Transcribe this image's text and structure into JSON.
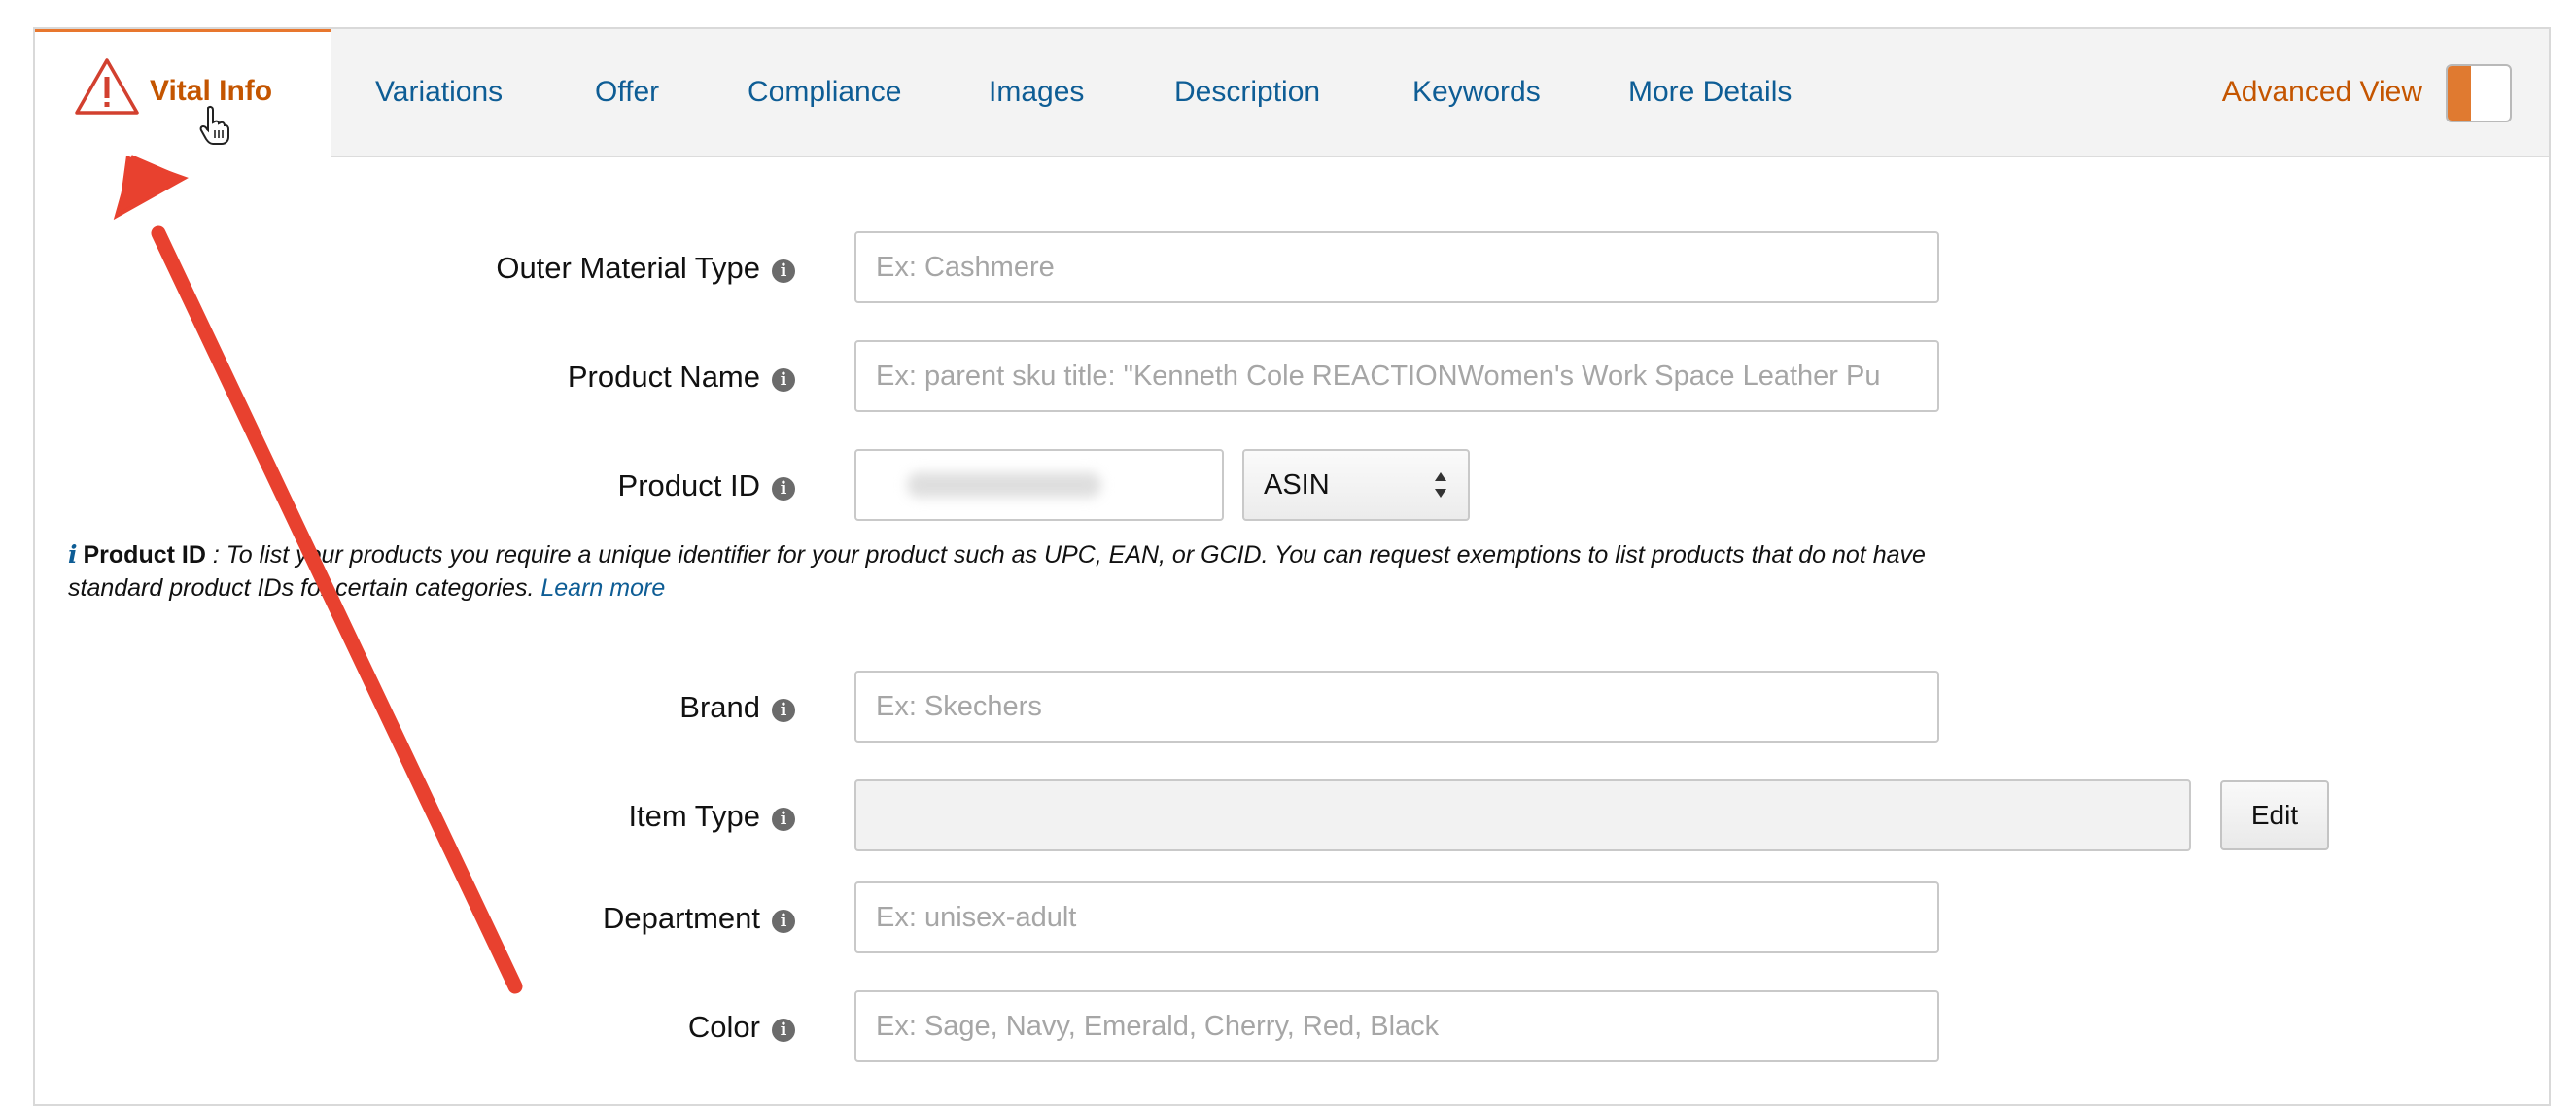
{
  "tabs": {
    "vital_info": "Vital Info",
    "variations": "Variations",
    "offer": "Offer",
    "compliance": "Compliance",
    "images": "Images",
    "description": "Description",
    "keywords": "Keywords",
    "more_details": "More Details"
  },
  "advanced_view": {
    "label": "Advanced View"
  },
  "form": {
    "outer_material": {
      "label": "Outer Material Type",
      "placeholder": "Ex: Cashmere"
    },
    "product_name": {
      "label": "Product Name",
      "placeholder": "Ex: parent sku title: \"Kenneth Cole REACTIONWomen's Work Space Leather Pu"
    },
    "product_id": {
      "label": "Product ID",
      "value": "",
      "type_selected": "ASIN"
    },
    "brand": {
      "label": "Brand",
      "placeholder": "Ex: Skechers"
    },
    "item_type": {
      "label": "Item Type",
      "edit_label": "Edit"
    },
    "department": {
      "label": "Department",
      "placeholder": "Ex: unisex-adult"
    },
    "color": {
      "label": "Color",
      "placeholder": "Ex: Sage, Navy, Emerald, Cherry, Red, Black"
    }
  },
  "note": {
    "title": "Product ID",
    "separator": ":",
    "text": "To list your products you require a unique identifier for your product such as UPC, EAN, or GCID. You can request exemptions to list products that do not have standard product IDs for certain categories.",
    "link": "Learn more"
  },
  "colors": {
    "accent": "#c45500",
    "link": "#0e5d95",
    "annotation_arrow": "#e8412f"
  }
}
